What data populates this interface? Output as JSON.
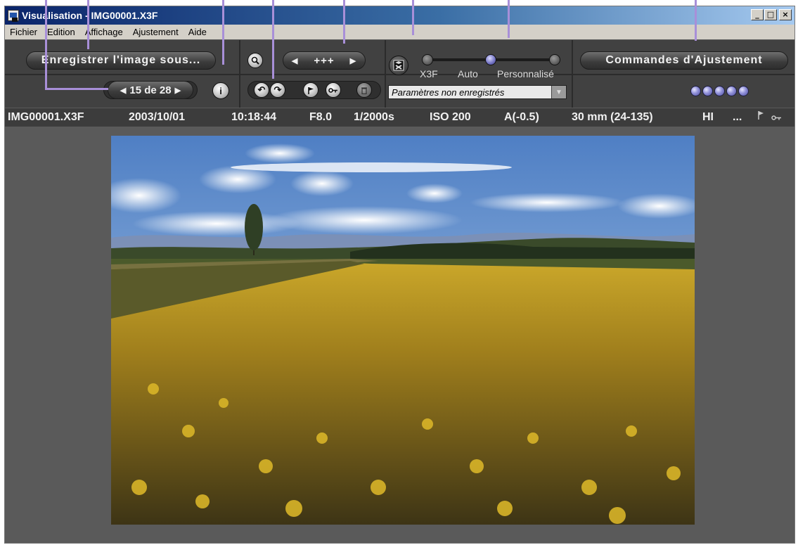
{
  "window": {
    "title": "Visualisation - IMG00001.X3F",
    "controls": [
      "_",
      "□",
      "×"
    ]
  },
  "menu": [
    "Fichier",
    "Edition",
    "Affichage",
    "Ajustement",
    "Aide"
  ],
  "toolbar": {
    "save_label": "Enregistrer l'image sous...",
    "navigator_label": "15 de 28",
    "zoom_label": "+++",
    "slider_labels": [
      "X3F",
      "Auto",
      "Personnalisé"
    ],
    "settings_dropdown": "Paramètres non enregistrés",
    "adjust_label": "Commandes d'Ajustement",
    "info_icon": "info-icon",
    "rotate_icons": [
      "rotate-left-icon",
      "rotate-right-icon"
    ],
    "action_icons": [
      "flag-icon",
      "key-icon",
      "trash-icon"
    ],
    "slider_value": "Personnalisé",
    "rating_dots": 5,
    "accent_color": "#a88fd8"
  },
  "info_bar": {
    "filename": "IMG00001.X3F",
    "date": "2003/10/01",
    "time": "10:18:44",
    "aperture": "F8.0",
    "shutter": "1/2000s",
    "iso": "ISO 200",
    "exposure": "A(-0.5)",
    "focal": "30 mm (24-135)",
    "quality": "HI",
    "more": "..."
  },
  "image": {
    "description_icon": "photo-sunflower-field"
  }
}
